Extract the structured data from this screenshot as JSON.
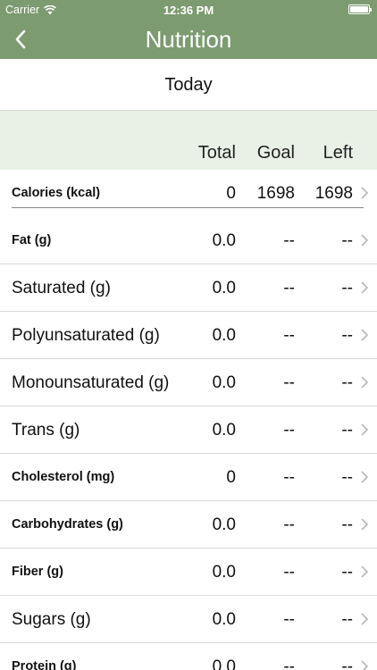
{
  "status": {
    "carrier": "Carrier",
    "time": "12:36 PM",
    "battery_level": 1.0
  },
  "nav": {
    "title": "Nutrition",
    "back_icon": "chevron-left-icon"
  },
  "segment": {
    "label": "Today"
  },
  "columns": {
    "total": "Total",
    "goal": "Goal",
    "left": "Left"
  },
  "rows": [
    {
      "label": "Calories (kcal)",
      "style": "bold",
      "total": "0",
      "goal": "1698",
      "left": "1698"
    },
    {
      "label": "Fat (g)",
      "style": "bold",
      "total": "0.0",
      "goal": "--",
      "left": "--"
    },
    {
      "label": "Saturated (g)",
      "style": "normal",
      "total": "0.0",
      "goal": "--",
      "left": "--"
    },
    {
      "label": "Polyunsaturated (g)",
      "style": "normal",
      "total": "0.0",
      "goal": "--",
      "left": "--"
    },
    {
      "label": "Monounsaturated (g)",
      "style": "normal",
      "total": "0.0",
      "goal": "--",
      "left": "--"
    },
    {
      "label": "Trans (g)",
      "style": "normal",
      "total": "0.0",
      "goal": "--",
      "left": "--"
    },
    {
      "label": "Cholesterol (mg)",
      "style": "bold",
      "total": "0",
      "goal": "--",
      "left": "--"
    },
    {
      "label": "Carbohydrates (g)",
      "style": "bold",
      "total": "0.0",
      "goal": "--",
      "left": "--"
    },
    {
      "label": "Fiber (g)",
      "style": "bold",
      "total": "0.0",
      "goal": "--",
      "left": "--"
    },
    {
      "label": "Sugars (g)",
      "style": "normal",
      "total": "0.0",
      "goal": "--",
      "left": "--"
    },
    {
      "label": "Protein (g)",
      "style": "bold",
      "total": "0.0",
      "goal": "--",
      "left": "--"
    }
  ],
  "colors": {
    "brand": "#7c9b70",
    "header_bg": "#e9f0e6"
  }
}
